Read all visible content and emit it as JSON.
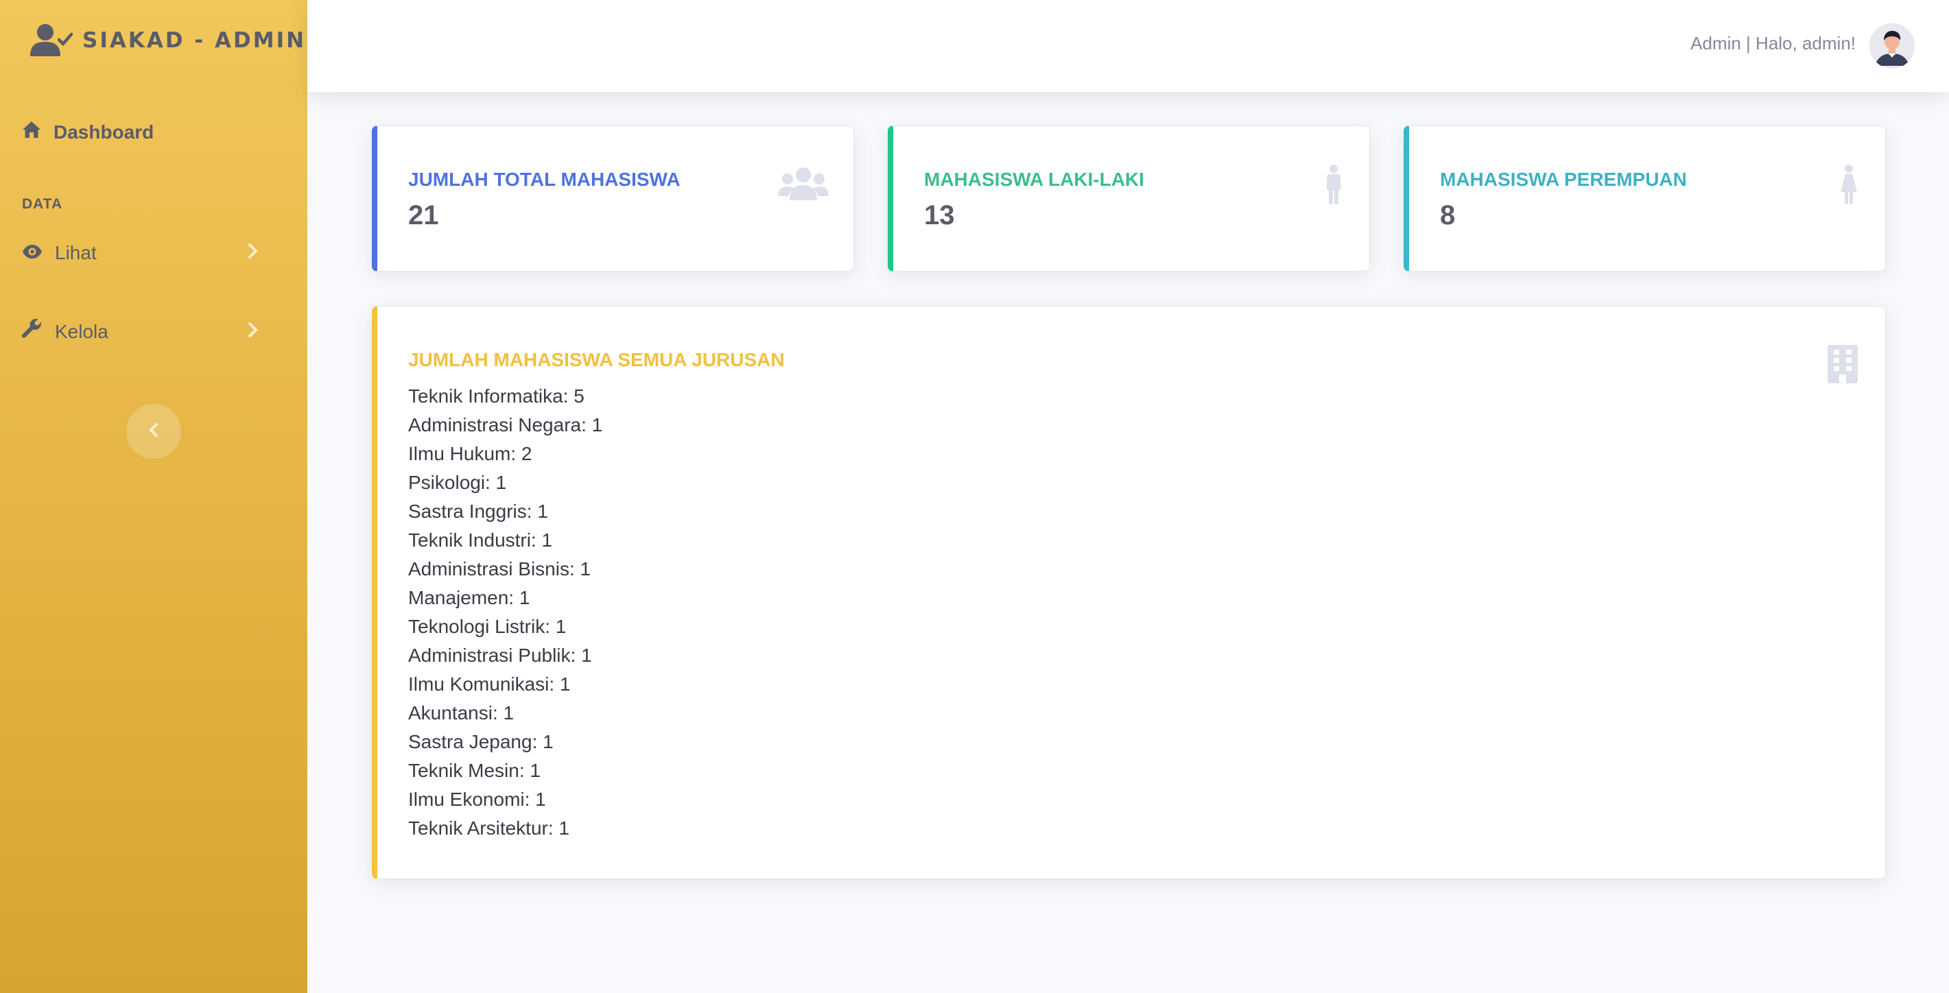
{
  "sidebar": {
    "brand": "SIAKAD - ADMIN",
    "brand_icon": "user-check-icon",
    "items": [
      {
        "label": "Dashboard",
        "icon": "home-icon"
      },
      {
        "label": "Lihat",
        "icon": "eye-icon"
      },
      {
        "label": "Kelola",
        "icon": "wrench-icon"
      }
    ],
    "heading": "DATA",
    "toggle_icon": "chevron-left-icon"
  },
  "topbar": {
    "user_text": "Admin | Halo, admin!",
    "avatar_icon": "avatar"
  },
  "cards": [
    {
      "label": "JUMLAH TOTAL MAHASISWA",
      "value": "21",
      "icon": "users-icon",
      "accent": "#4e73df"
    },
    {
      "label": "MAHASISWA LAKI-LAKI",
      "value": "13",
      "icon": "male-icon",
      "accent": "#1cc88a"
    },
    {
      "label": "MAHASISWA PEREMPUAN",
      "value": "8",
      "icon": "female-icon",
      "accent": "#36b9cc"
    }
  ],
  "majors_card": {
    "title": "JUMLAH MAHASISWA SEMUA JURUSAN",
    "icon": "building-icon",
    "accent": "#f6c23e",
    "items": [
      "Teknik Informatika: 5",
      "Administrasi Negara: 1",
      "Ilmu Hukum: 2",
      "Psikologi: 1",
      "Sastra Inggris: 1",
      "Teknik Industri: 1",
      "Administrasi Bisnis: 1",
      "Manajemen: 1",
      "Teknologi Listrik: 1",
      "Administrasi Publik: 1",
      "Ilmu Komunikasi: 1",
      "Akuntansi: 1",
      "Sastra Jepang: 1",
      "Teknik Mesin: 1",
      "Ilmu Ekonomi: 1",
      "Teknik Arsitektur: 1"
    ]
  },
  "colors": {
    "sidebar_top": "#f1c75a",
    "sidebar_bottom": "#d6a430",
    "background": "#f8f9fc"
  }
}
